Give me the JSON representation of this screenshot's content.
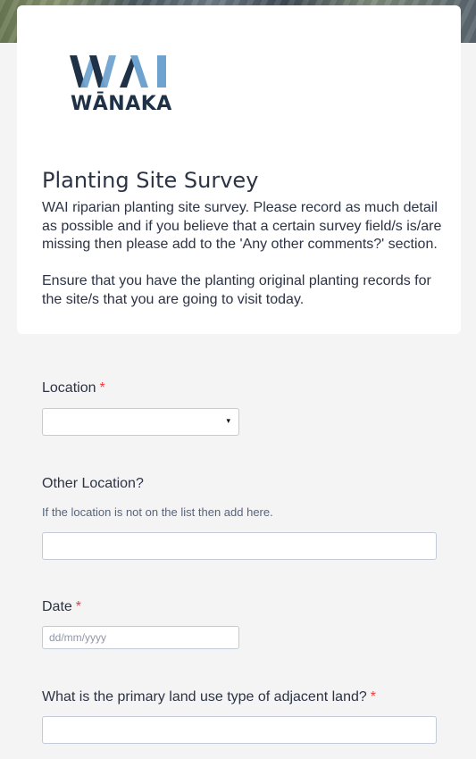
{
  "header": {
    "logo": {
      "wordmark_top": "WAI",
      "wordmark_bottom": "WĀNAKA",
      "colors": {
        "dark": "#1e3147",
        "light": "#6fa3cf"
      }
    },
    "title": "Planting Site Survey",
    "description": [
      "WAI riparian planting site survey. Please record as much detail as possible and if you believe that a certain survey field/s is/are missing then please add to the 'Any other comments?' section.",
      "Ensure that you have the planting original planting records for the site/s that you are going to visit today."
    ]
  },
  "fields": {
    "location": {
      "label": "Location",
      "required_mark": "*",
      "selected_value": "",
      "arrow": "▾"
    },
    "other_location": {
      "label": "Other Location?",
      "sublabel": "If the location is not on the list then add here.",
      "value": ""
    },
    "date": {
      "label": "Date",
      "required_mark": "*",
      "placeholder": "dd/mm/yyyy",
      "value": ""
    },
    "land_use": {
      "label": "What is the primary land use type of adjacent land?",
      "required_mark": "*",
      "value": ""
    }
  },
  "colors": {
    "required": "#f23a3c",
    "text": "#2c3345",
    "border": "#c3cad8",
    "background": "#f4f4f4"
  },
  "icons": {
    "select_arrow": "caret-down-icon"
  }
}
